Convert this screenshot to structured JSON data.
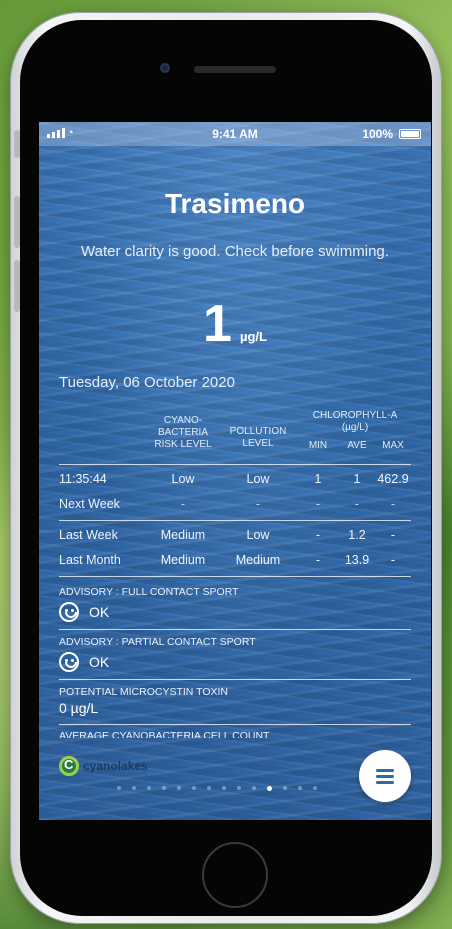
{
  "status_bar": {
    "time": "9:41 AM",
    "battery": "100%"
  },
  "lake": {
    "name": "Trasimeno",
    "clarity_message": "Water clarity is good. Check before swimming.",
    "reading_value": "1",
    "reading_unit": "µg/L",
    "date": "Tuesday, 06 October 2020"
  },
  "table": {
    "headers": {
      "cyano": "CYANO-\nBACTERIA\nRISK LEVEL",
      "pollution": "POLLUTION\nLEVEL",
      "chlorophyll": "CHLOROPHYLL-A",
      "chlorophyll_unit": "(µg/L)",
      "min": "MIN",
      "ave": "AVE",
      "max": "MAX"
    },
    "rows": [
      {
        "label": "11:35:44",
        "cyano": "Low",
        "pollution": "Low",
        "min": "1",
        "ave": "1",
        "max": "462.9"
      },
      {
        "label": "Next Week",
        "cyano": "-",
        "pollution": "-",
        "min": "-",
        "ave": "-",
        "max": "-"
      },
      {
        "label": "Last Week",
        "cyano": "Medium",
        "pollution": "Low",
        "min": "-",
        "ave": "1.2",
        "max": "-"
      },
      {
        "label": "Last Month",
        "cyano": "Medium",
        "pollution": "Medium",
        "min": "-",
        "ave": "13.9",
        "max": "-"
      }
    ]
  },
  "advisories": [
    {
      "label": "ADVISORY : FULL CONTACT SPORT",
      "value": "OK",
      "icon": "smile-icon"
    },
    {
      "label": "ADVISORY : PARTIAL CONTACT SPORT",
      "value": "OK",
      "icon": "smile-icon"
    },
    {
      "label": "POTENTIAL MICROCYSTIN TOXIN",
      "value": "0 µg/L"
    },
    {
      "label": "AVERAGE CYANOBACTERIA CELL COUNT",
      "value": ""
    }
  ],
  "brand": {
    "logo_text": "cyanolakes"
  },
  "pager": {
    "count": 14,
    "active_index": 10
  },
  "colors": {
    "water": "#3068a8",
    "menu_icon": "#2e6aa3"
  }
}
